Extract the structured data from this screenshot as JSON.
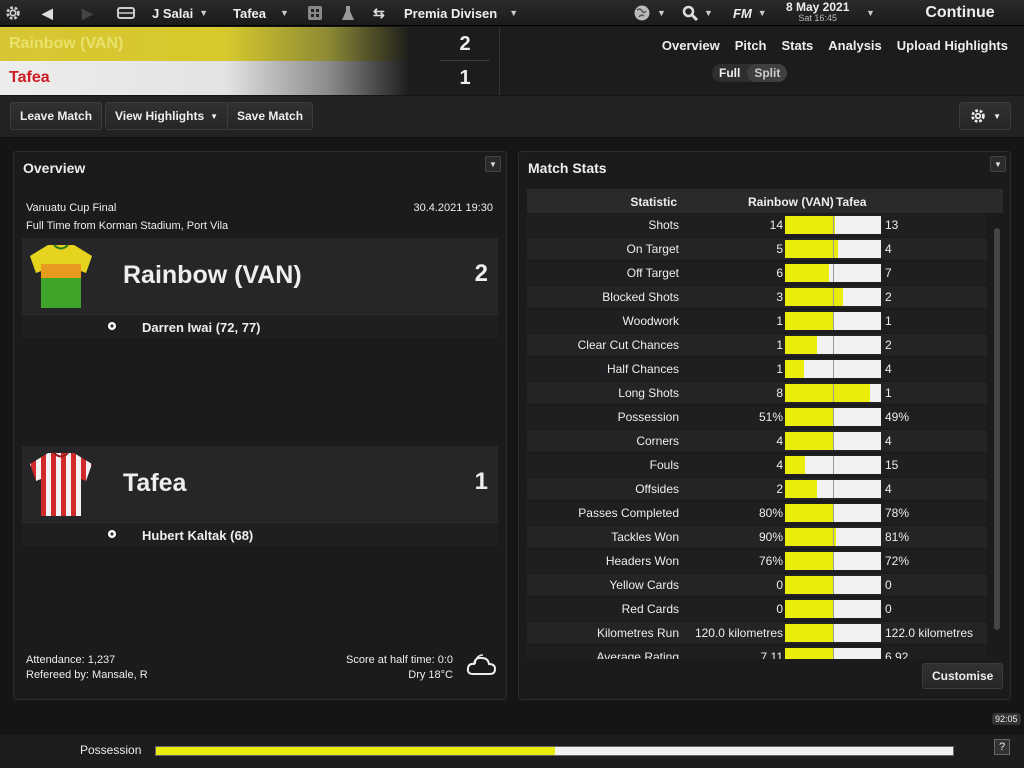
{
  "topbar": {
    "manager": "J Salai",
    "club": "Tafea",
    "competition": "Premia Divisen",
    "brand": "FM",
    "date": "8 May 2021",
    "day_time": "Sat 16:45",
    "continue_label": "Continue"
  },
  "header": {
    "home_team": "Rainbow (VAN)",
    "away_team": "Tafea",
    "home_score": "2",
    "away_score": "1",
    "tabs": [
      "Overview",
      "Pitch",
      "Stats",
      "Analysis",
      "Upload Highlights"
    ],
    "view_full": "Full",
    "view_split": "Split"
  },
  "toolbar": {
    "leave": "Leave Match",
    "highlights": "View Highlights",
    "save": "Save Match"
  },
  "overview": {
    "title": "Overview",
    "competition": "Vanuatu Cup Final",
    "datetime": "30.4.2021 19:30",
    "venue": "Full Time from Korman Stadium, Port Vila",
    "home": {
      "name": "Rainbow (VAN)",
      "score": "2",
      "scorers": "Darren Iwai (72, 77)"
    },
    "away": {
      "name": "Tafea",
      "score": "1",
      "scorers": "Hubert Kaltak (68)"
    },
    "attendance": "Attendance: 1,237",
    "referee": "Refereed by: Mansale, R",
    "halftime": "Score at half time: 0:0",
    "weather": "Dry 18°C"
  },
  "stats": {
    "title": "Match Stats",
    "col_stat": "Statistic",
    "col_home": "Rainbow (VAN)",
    "col_away": "Tafea",
    "rows": [
      {
        "label": "Shots",
        "home": "14",
        "away": "13",
        "h": 14,
        "a": 13
      },
      {
        "label": "On Target",
        "home": "5",
        "away": "4",
        "h": 5,
        "a": 4
      },
      {
        "label": "Off Target",
        "home": "6",
        "away": "7",
        "h": 6,
        "a": 7
      },
      {
        "label": "Blocked Shots",
        "home": "3",
        "away": "2",
        "h": 3,
        "a": 2
      },
      {
        "label": "Woodwork",
        "home": "1",
        "away": "1",
        "h": 1,
        "a": 1
      },
      {
        "label": "Clear Cut Chances",
        "home": "1",
        "away": "2",
        "h": 1,
        "a": 2
      },
      {
        "label": "Half Chances",
        "home": "1",
        "away": "4",
        "h": 1,
        "a": 4
      },
      {
        "label": "Long Shots",
        "home": "8",
        "away": "1",
        "h": 8,
        "a": 1
      },
      {
        "label": "Possession",
        "home": "51%",
        "away": "49%",
        "h": 51,
        "a": 49
      },
      {
        "label": "Corners",
        "home": "4",
        "away": "4",
        "h": 4,
        "a": 4
      },
      {
        "label": "Fouls",
        "home": "4",
        "away": "15",
        "h": 4,
        "a": 15
      },
      {
        "label": "Offsides",
        "home": "2",
        "away": "4",
        "h": 2,
        "a": 4
      },
      {
        "label": "Passes Completed",
        "home": "80%",
        "away": "78%",
        "h": 80,
        "a": 78
      },
      {
        "label": "Tackles Won",
        "home": "90%",
        "away": "81%",
        "h": 90,
        "a": 81
      },
      {
        "label": "Headers Won",
        "home": "76%",
        "away": "72%",
        "h": 76,
        "a": 72
      },
      {
        "label": "Yellow Cards",
        "home": "0",
        "away": "0",
        "h": 0,
        "a": 0
      },
      {
        "label": "Red Cards",
        "home": "0",
        "away": "0",
        "h": 0,
        "a": 0
      },
      {
        "label": "Kilometres Run",
        "home": "120.0 kilometres",
        "away": "122.0 kilometres",
        "h": 120,
        "a": 122
      },
      {
        "label": "Average Rating",
        "home": "7.11",
        "away": "6.92",
        "h": 7.11,
        "a": 6.92
      }
    ],
    "customise": "Customise"
  },
  "bottom": {
    "possession_label": "Possession",
    "possession_home_fraction": 0.5,
    "clock": "92:05",
    "help": "?"
  },
  "colors": {
    "accent_yellow": "#ecec0c",
    "away_red": "#cf1b24"
  },
  "icons": [
    "gear-icon",
    "back-arrow-icon",
    "forward-arrow-icon",
    "inbox-icon",
    "calculator-icon",
    "flask-icon",
    "swap-arrows-icon",
    "globe-icon",
    "search-icon",
    "football-icon",
    "cloud-icon",
    "help-icon"
  ]
}
